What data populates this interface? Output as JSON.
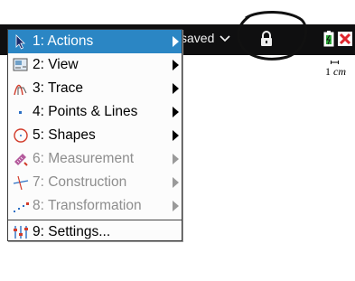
{
  "title_bar": {
    "doc_status": "saved",
    "lock_icon": "lock-icon",
    "battery_icon": "battery-icon",
    "close_icon": "close-icon"
  },
  "scale": {
    "value": "1",
    "unit": "cm"
  },
  "menu": {
    "items": [
      {
        "label": "1: Actions",
        "icon": "pointer-arrow-icon",
        "submenu": true,
        "state": "selected"
      },
      {
        "label": "2: View",
        "icon": "view-icon",
        "submenu": true,
        "state": "enabled"
      },
      {
        "label": "3: Trace",
        "icon": "trace-icon",
        "submenu": true,
        "state": "enabled"
      },
      {
        "label": "4: Points & Lines",
        "icon": "point-icon",
        "submenu": true,
        "state": "enabled"
      },
      {
        "label": "5: Shapes",
        "icon": "circle-icon",
        "submenu": true,
        "state": "enabled"
      },
      {
        "label": "6: Measurement",
        "icon": "ruler-icon",
        "submenu": true,
        "state": "disabled"
      },
      {
        "label": "7: Construction",
        "icon": "construction-icon",
        "submenu": true,
        "state": "disabled"
      },
      {
        "label": "8: Transformation",
        "icon": "transformation-icon",
        "submenu": true,
        "state": "disabled"
      },
      {
        "label": "9: Settings...",
        "icon": "settings-icon",
        "submenu": false,
        "state": "enabled"
      }
    ]
  },
  "colors": {
    "title_bar": "#0f0f10",
    "selection": "#2b86c4",
    "disabled_text": "#8e8e8e",
    "close": "#e0262d"
  }
}
